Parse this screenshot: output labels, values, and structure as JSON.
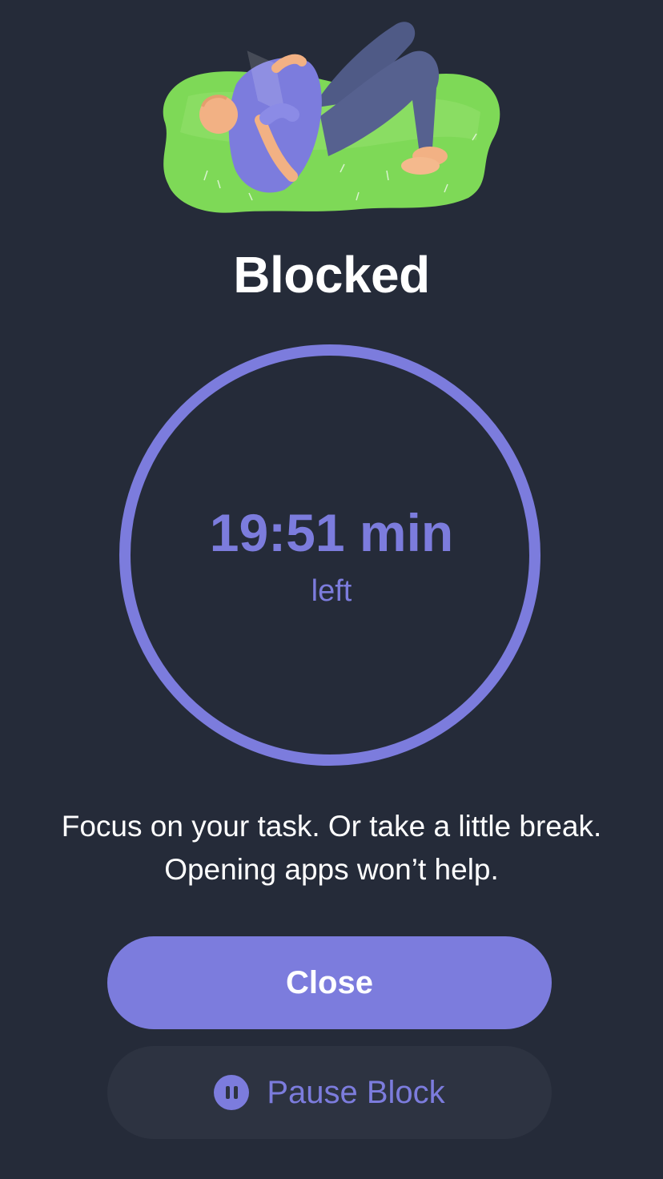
{
  "screen": {
    "title": "Blocked",
    "timer": {
      "value": "19:51 min",
      "sub": "left"
    },
    "message": "Focus on your task. Or take a little break. Opening apps won’t help.",
    "buttons": {
      "close_label": "Close",
      "pause_label": "Pause Block"
    },
    "icons": {
      "pause": "pause-icon",
      "illustration": "person-reading-on-grass-illustration"
    }
  },
  "colors": {
    "background": "#252b39",
    "accent": "#7c7cdd",
    "secondary_button": "#2d3341",
    "text": "#ffffff"
  }
}
